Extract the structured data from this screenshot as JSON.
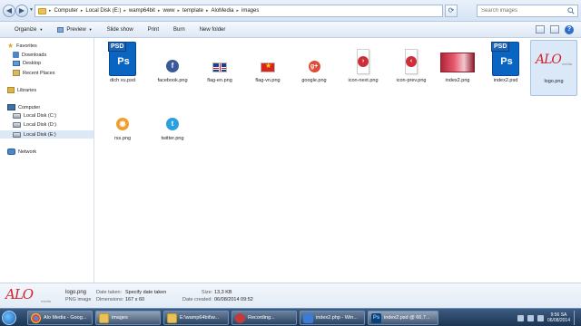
{
  "address": {
    "crumbs": [
      "Computer",
      "Local Disk (E:)",
      "wamp64bit",
      "www",
      "template",
      "AloMedia",
      "images"
    ],
    "search_placeholder": "Search images"
  },
  "toolbar": {
    "organize": "Organize",
    "preview": "Preview",
    "slideshow": "Slide show",
    "print": "Print",
    "burn": "Burn",
    "new_folder": "New folder"
  },
  "nav": {
    "favorites": "Favorites",
    "downloads": "Downloads",
    "desktop": "Desktop",
    "recent_places": "Recent Places",
    "libraries": "Libraries",
    "computer": "Computer",
    "disk_c": "Local Disk (C:)",
    "disk_d": "Local Disk (D:)",
    "disk_e": "Local Disk (E:)",
    "network": "Network"
  },
  "files": [
    {
      "name": "dich vu.psd",
      "icon": "photoshop-psd-icon"
    },
    {
      "name": "facebook.png",
      "icon": "facebook-icon"
    },
    {
      "name": "flag-en.png",
      "icon": "flag-en-icon"
    },
    {
      "name": "flag-vn.png",
      "icon": "flag-vn-icon"
    },
    {
      "name": "google.png",
      "icon": "google-plus-icon"
    },
    {
      "name": "icon-next.png",
      "icon": "next-arrow-icon"
    },
    {
      "name": "icon-prev.png",
      "icon": "prev-arrow-icon"
    },
    {
      "name": "index2.png",
      "icon": "image-thumbnail"
    },
    {
      "name": "index2.psd",
      "icon": "photoshop-psd-icon"
    },
    {
      "name": "logo.png",
      "icon": "alo-logo-thumbnail",
      "selected": true
    },
    {
      "name": "rss.png",
      "icon": "rss-icon"
    },
    {
      "name": "twitter.png",
      "icon": "twitter-icon"
    }
  ],
  "psd_tag": "PSD",
  "ps_glyph": "Ps",
  "logo_text": "ALO",
  "logo_sub": "media",
  "details": {
    "name": "logo.png",
    "type": "PNG image",
    "date_taken_label": "Date taken:",
    "date_taken_value": "Specify date taken",
    "dimensions_label": "Dimensions:",
    "dimensions_value": "167 x 60",
    "size_label": "Size:",
    "size_value": "13,3 KB",
    "date_created_label": "Date created:",
    "date_created_value": "06/08/2014 09:52"
  },
  "taskbar": {
    "tasks": [
      {
        "label": "Alo Media - Goog...",
        "icon": "chrome-icon"
      },
      {
        "label": "images",
        "icon": "explorer-folder-icon"
      },
      {
        "label": "E:\\wamp64bit\\w...",
        "icon": "explorer-folder-icon"
      },
      {
        "label": "Recording...",
        "icon": "recorder-icon"
      },
      {
        "label": "index2.php - Win...",
        "icon": "editor-icon"
      },
      {
        "label": "index2.psd @ 66,7...",
        "icon": "photoshop-icon"
      }
    ],
    "time": "9:56 SA",
    "date": "06/08/2014"
  },
  "colors": {
    "accent": "#0a64c2",
    "selection": "#dbe8f8",
    "taskbar": "#1c3553"
  }
}
